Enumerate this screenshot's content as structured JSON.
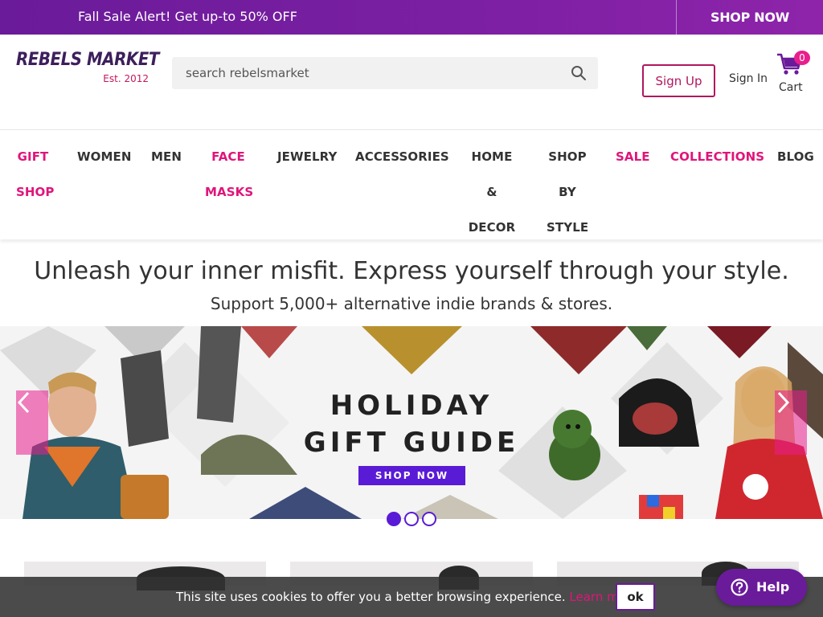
{
  "promo": {
    "text": "Fall Sale Alert! Get up-to 50% OFF",
    "cta": "SHOP NOW"
  },
  "header": {
    "logo": "REBELS MARKET",
    "logo_tagline": "Est. 2012",
    "search_placeholder": "search rebelsmarket",
    "signup_label": "Sign Up",
    "signin_label": "Sign In",
    "cart_label": "Cart",
    "cart_count": "0"
  },
  "nav": {
    "items": [
      {
        "line1": "GIFT",
        "line2": "SHOP",
        "line3": ""
      },
      {
        "line1": "WOMEN",
        "line2": "",
        "line3": ""
      },
      {
        "line1": "MEN",
        "line2": "",
        "line3": ""
      },
      {
        "line1": "FACE",
        "line2": "MASKS",
        "line3": ""
      },
      {
        "line1": "JEWELRY",
        "line2": "",
        "line3": ""
      },
      {
        "line1": "ACCESSORIES",
        "line2": "",
        "line3": ""
      },
      {
        "line1": "HOME &",
        "line2": "DECOR",
        "line3": ""
      },
      {
        "line1": "SHOP",
        "line2": "BY",
        "line3": "STYLE"
      },
      {
        "line1": "SALE",
        "line2": "",
        "line3": ""
      },
      {
        "line1": "COLLECTIONS",
        "line2": "",
        "line3": ""
      },
      {
        "line1": "BLOG",
        "line2": "",
        "line3": ""
      }
    ]
  },
  "hero": {
    "headline": "Unleash your inner misfit. Express yourself through your style.",
    "subline": "Support 5,000+ alternative indie brands & stores."
  },
  "banner": {
    "title_line1": "HOLIDAY",
    "title_line2": "GIFT GUIDE",
    "cta": "SHOP NOW",
    "slide_count": 3,
    "active_slide": 1
  },
  "cookie": {
    "text": "This site uses cookies to offer you a better browsing experience.",
    "link": "Learn more",
    "ok": "ok"
  },
  "help": {
    "label": "Help"
  },
  "colors": {
    "brand_purple": "#6a1b9a",
    "accent_pink": "#e0157a",
    "cta_purple": "#5a1bd6"
  }
}
